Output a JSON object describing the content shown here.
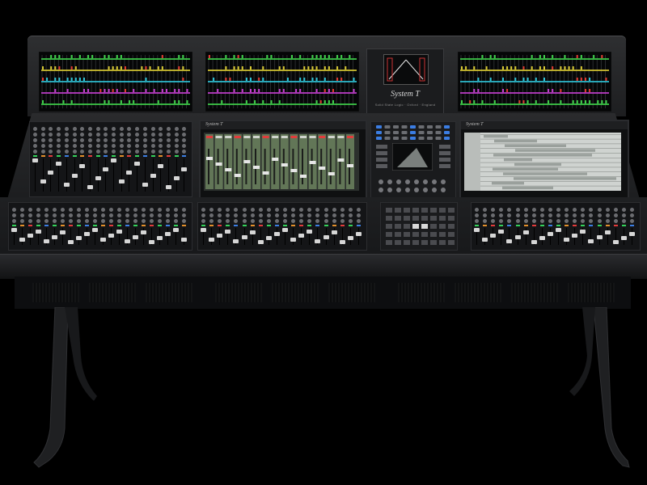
{
  "product": {
    "name": "System T",
    "subtitle": "Solid State Logic · Oxford · England"
  },
  "screens": {
    "left_brand": "System T",
    "right_brand": "System T",
    "left_menu": "Solid State Logic  |  Oxford  |  England",
    "right_menu": "Solid State Logic  |  Oxford  |  England"
  },
  "colors": {
    "background": "#000000",
    "console_body": "#1f2022",
    "meter_green": "#3fd04a",
    "meter_cyan": "#2fc3d6",
    "meter_magenta": "#c43fcf",
    "meter_yellow": "#d8c933",
    "meter_red": "#e0392f",
    "led_red": "#e23b3b",
    "led_green": "#34d15a",
    "led_blue": "#3b7de2",
    "led_orange": "#e28f2b",
    "screen_green": "#8fb07a",
    "screen_gray": "#9aa09c"
  }
}
